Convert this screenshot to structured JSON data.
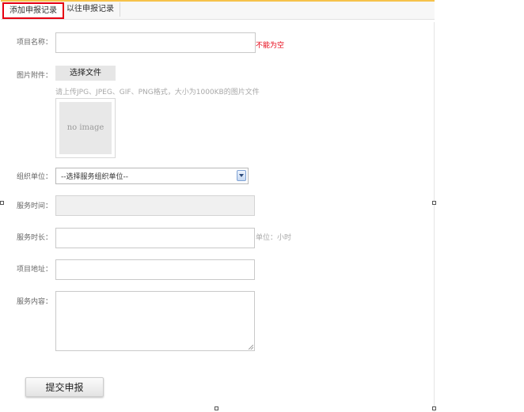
{
  "tabs": [
    {
      "label": "添加申报记录",
      "active": true
    },
    {
      "label": "以往申报记录",
      "active": false
    }
  ],
  "form": {
    "project_name": {
      "label": "项目名称：",
      "value": "",
      "error": "不能为空"
    },
    "attachment": {
      "label": "图片附件：",
      "button": "选择文件",
      "hint": "请上传JPG、JPEG、GIF、PNG格式，大小为1000KB的图片文件",
      "placeholder_image": "no image"
    },
    "organization": {
      "label": "组织单位：",
      "selected": "--选择服务组织单位--"
    },
    "service_time": {
      "label": "服务时间：",
      "value": ""
    },
    "service_duration": {
      "label": "服务时长：",
      "value": "",
      "unit": "单位：小时"
    },
    "project_address": {
      "label": "项目地址：",
      "value": ""
    },
    "service_content": {
      "label": "服务内容：",
      "value": ""
    }
  },
  "submit_button": "提交申报",
  "colors": {
    "accent_bar": "#f6c24a",
    "active_tab_border": "#e60012",
    "error_text": "#e60012"
  }
}
